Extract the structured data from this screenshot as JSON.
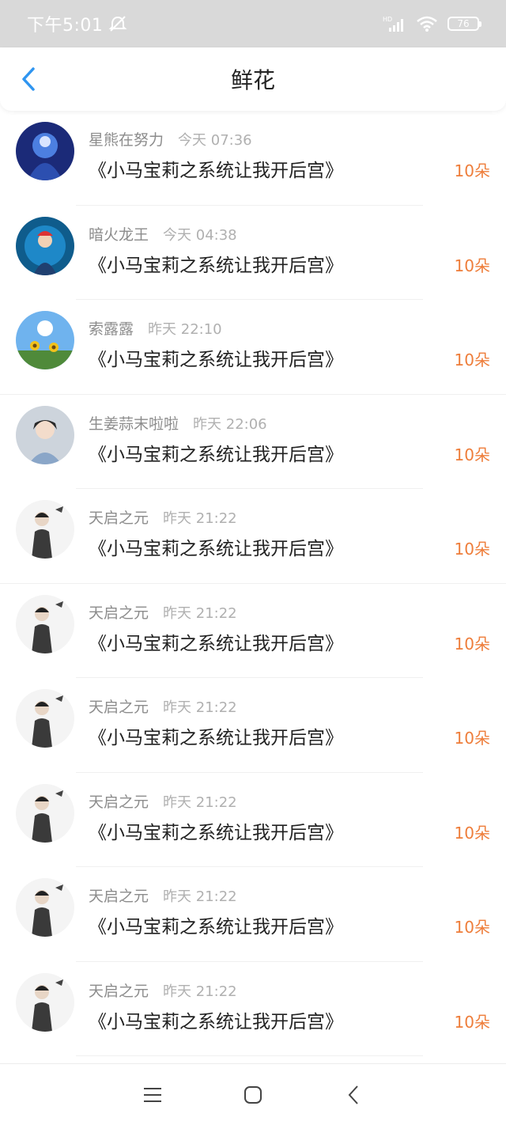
{
  "status_bar": {
    "time": "下午5:01",
    "battery": "76"
  },
  "header": {
    "title": "鲜花"
  },
  "items": [
    {
      "name": "星熊在努力",
      "time": "今天 07:36",
      "book": "《小马宝莉之系统让我开后宫》",
      "count": "10朵"
    },
    {
      "name": "暗火龙王",
      "time": "今天 04:38",
      "book": "《小马宝莉之系统让我开后宫》",
      "count": "10朵"
    },
    {
      "name": "索露露",
      "time": "昨天 22:10",
      "book": "《小马宝莉之系统让我开后宫》",
      "count": "10朵"
    },
    {
      "name": "生姜蒜末啦啦",
      "time": "昨天 22:06",
      "book": "《小马宝莉之系统让我开后宫》",
      "count": "10朵"
    },
    {
      "name": "天启之元",
      "time": "昨天 21:22",
      "book": "《小马宝莉之系统让我开后宫》",
      "count": "10朵"
    },
    {
      "name": "天启之元",
      "time": "昨天 21:22",
      "book": "《小马宝莉之系统让我开后宫》",
      "count": "10朵"
    },
    {
      "name": "天启之元",
      "time": "昨天 21:22",
      "book": "《小马宝莉之系统让我开后宫》",
      "count": "10朵"
    },
    {
      "name": "天启之元",
      "time": "昨天 21:22",
      "book": "《小马宝莉之系统让我开后宫》",
      "count": "10朵"
    },
    {
      "name": "天启之元",
      "time": "昨天 21:22",
      "book": "《小马宝莉之系统让我开后宫》",
      "count": "10朵"
    },
    {
      "name": "天启之元",
      "time": "昨天 21:22",
      "book": "《小马宝莉之系统让我开后宫》",
      "count": "10朵"
    }
  ],
  "colors": {
    "accent_blue": "#2f95f0",
    "flower_orange": "#ee7d3a"
  },
  "icons": {
    "back": "chevron-left-icon",
    "menu": "menu-icon",
    "home": "home-square-icon",
    "back_nav": "back-triangle-icon"
  }
}
